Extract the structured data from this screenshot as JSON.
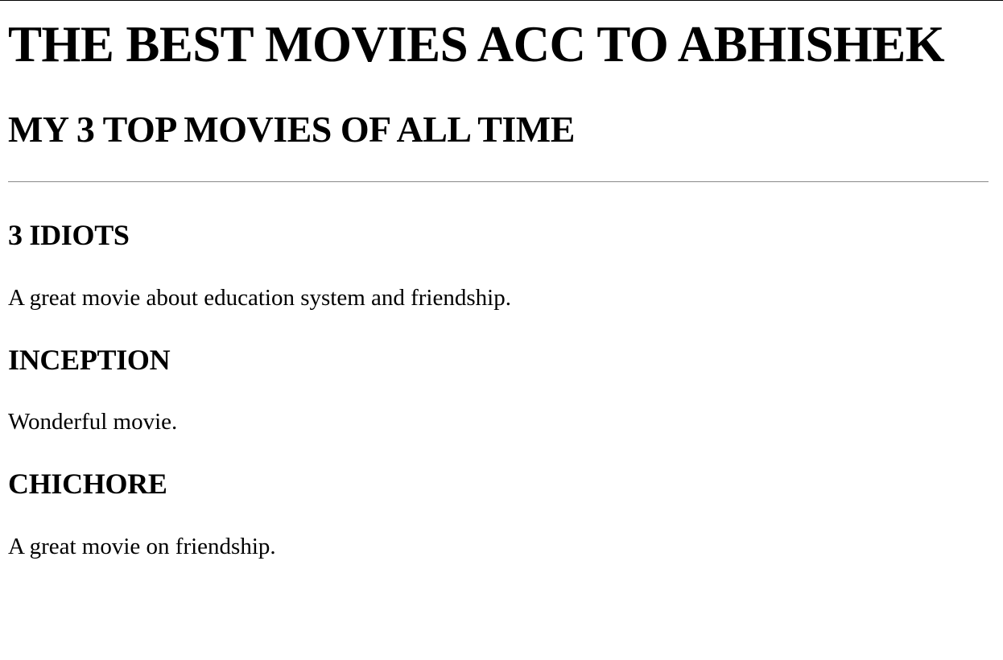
{
  "page": {
    "title": "THE BEST MOVIES ACC TO ABHISHEK",
    "subtitle": "MY 3 TOP MOVIES OF ALL TIME"
  },
  "movies": [
    {
      "title": "3 IDIOTS",
      "description": "A great movie about education system and friendship."
    },
    {
      "title": "INCEPTION",
      "description": "Wonderful movie."
    },
    {
      "title": "CHICHORE",
      "description": "A great movie on friendship."
    }
  ]
}
